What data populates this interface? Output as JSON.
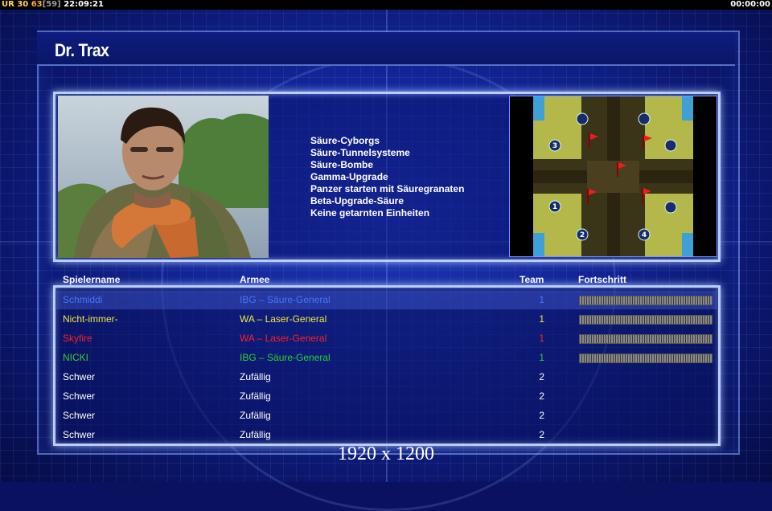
{
  "hud": {
    "tag": "UR",
    "fps": "30",
    "value": "63",
    "bracket_value": "[59]",
    "clock": "22:09:21",
    "timer": "00:00:00"
  },
  "general": {
    "name": "Dr. Trax",
    "features": [
      "Säure-Cyborgs",
      "Säure-Tunnelsysteme",
      "Säure-Bombe",
      "Gamma-Upgrade",
      "Panzer starten mit Säuregranaten",
      "Beta-Upgrade-Säure",
      "Keine getarnten Einheiten"
    ]
  },
  "minimap": {
    "start_positions": [
      "1",
      "2",
      "3",
      "4"
    ]
  },
  "table": {
    "headers": {
      "name": "Spielername",
      "army": "Armee",
      "team": "Team",
      "progress": "Fortschritt"
    },
    "rows": [
      {
        "name": "Schmiddi",
        "army": "IBG – Säure-General",
        "team": "1",
        "color": "#4a72ff",
        "progress": 1.0
      },
      {
        "name": "Nicht-immer-",
        "army": "WA – Laser-General",
        "team": "1",
        "color": "#f0e840",
        "progress": 1.0
      },
      {
        "name": "Skyfire",
        "army": "WA – Laser-General",
        "team": "1",
        "color": "#ff2020",
        "progress": 1.0
      },
      {
        "name": "NICKI",
        "army": "IBG – Säure-General",
        "team": "1",
        "color": "#30d030",
        "progress": 1.0
      },
      {
        "name": "Schwer",
        "army": "Zufällig",
        "team": "2",
        "color": "#ffffff"
      },
      {
        "name": "Schwer",
        "army": "Zufällig",
        "team": "2",
        "color": "#ffffff"
      },
      {
        "name": "Schwer",
        "army": "Zufällig",
        "team": "2",
        "color": "#ffffff"
      },
      {
        "name": "Schwer",
        "army": "Zufällig",
        "team": "2",
        "color": "#ffffff"
      }
    ]
  },
  "resolution_label": "1920 x 1200"
}
